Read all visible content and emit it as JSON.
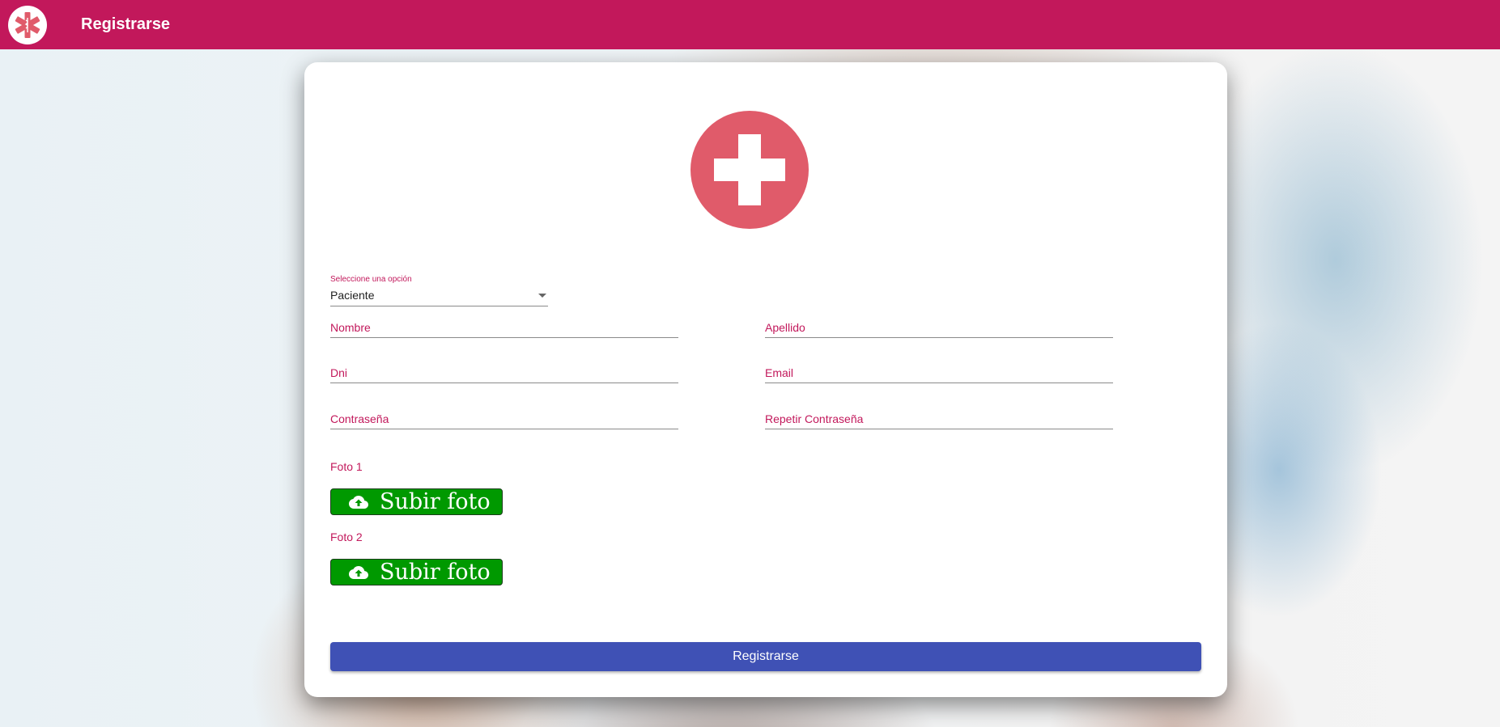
{
  "app": {
    "title": "Registrarse",
    "logo_icon": "star-of-life-icon",
    "bar_color": "#c2185b"
  },
  "form": {
    "hero_icon": "medical-cross-icon",
    "select": {
      "label": "Seleccione una opción",
      "value": "Paciente"
    },
    "fields": {
      "nombre": "Nombre",
      "apellido": "Apellido",
      "dni": "Dni",
      "email": "Email",
      "password": "Contraseña",
      "repeat_password": "Repetir Contraseña"
    },
    "foto1_label": "Foto 1",
    "foto2_label": "Foto 2",
    "upload_label": "Subir foto",
    "upload_icon": "cloud-upload-icon",
    "submit_label": "Registrarse",
    "colors": {
      "accent": "#c2185b",
      "upload": "#009900",
      "submit": "#3f51b5",
      "hero": "#e05b6a"
    }
  }
}
